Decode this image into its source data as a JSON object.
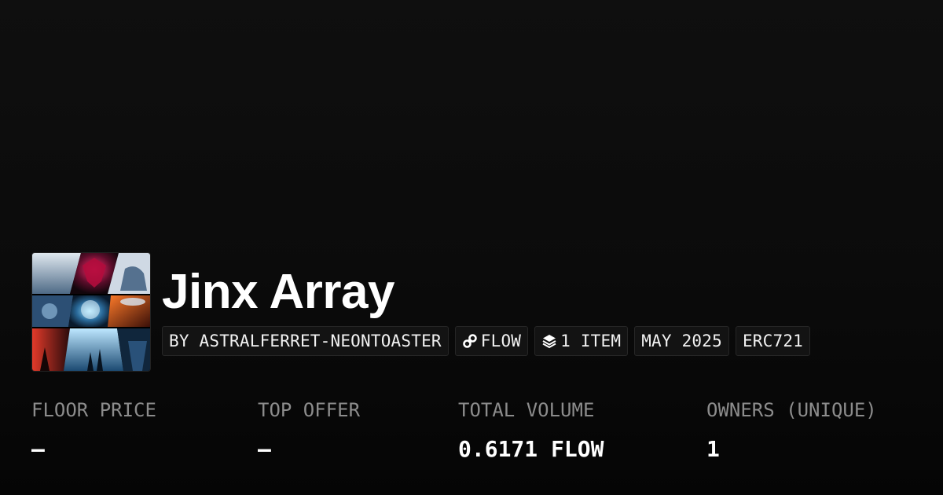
{
  "collection": {
    "name": "Jinx Array",
    "thumbnail_icon": "collection-artwork-collage"
  },
  "tags": [
    {
      "label": "BY ASTRALFERRET-NEONTOASTER"
    },
    {
      "label": "FLOW",
      "icon": "flow-chain-icon"
    },
    {
      "label": "1 ITEM",
      "icon": "layers-icon"
    },
    {
      "label": "MAY 2025"
    },
    {
      "label": "ERC721"
    }
  ],
  "stats": [
    {
      "label": "FLOOR PRICE",
      "value": "—"
    },
    {
      "label": "TOP OFFER",
      "value": "—"
    },
    {
      "label": "TOTAL VOLUME",
      "value": "0.6171 FLOW"
    },
    {
      "label": "OWNERS (UNIQUE)",
      "value": "1"
    }
  ],
  "colors": {
    "background": "#0b0b0b",
    "text": "#ffffff",
    "muted": "#8c8c8c",
    "tag_bg": "#131313",
    "tag_border": "#262626"
  }
}
